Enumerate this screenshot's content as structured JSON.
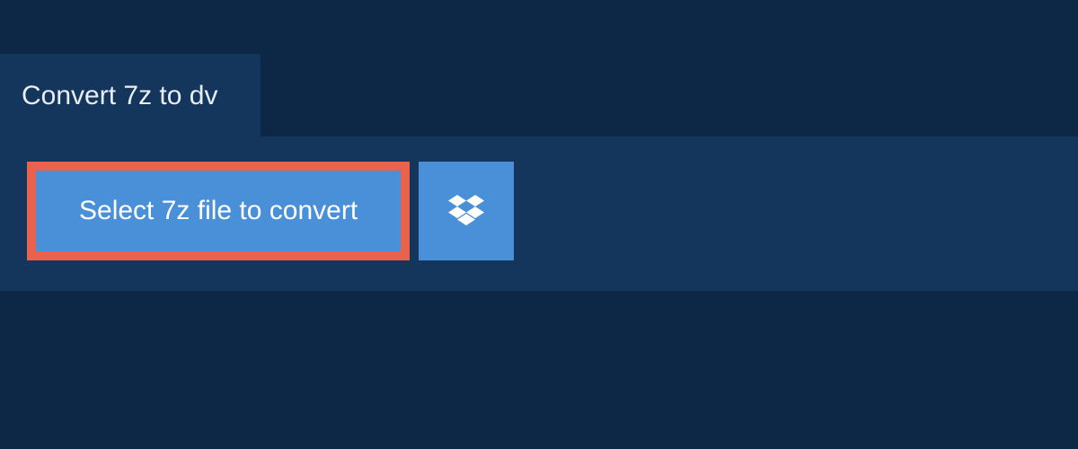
{
  "tab": {
    "label": "Convert 7z to dv"
  },
  "actions": {
    "select_file_label": "Select 7z file to convert"
  },
  "colors": {
    "page_bg": "#0d2847",
    "panel_bg": "#14365d",
    "button_bg": "#4a90d9",
    "highlight_border": "#e8624e",
    "text_light": "#e8eef5"
  }
}
